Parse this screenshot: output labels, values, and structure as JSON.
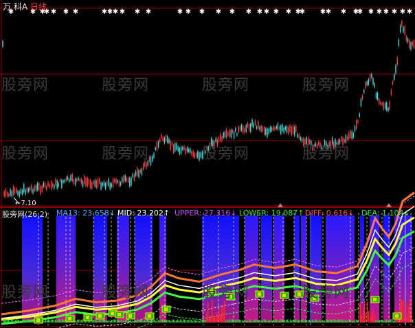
{
  "window_title": {
    "stock_name": "万 科A",
    "timeframe": "日线"
  },
  "main_chart": {
    "low_label": "7.10"
  },
  "indicator": {
    "name": "股旁网(26,2)",
    "items": [
      {
        "label": "MA13: 23.658↓",
        "color": "#4aa8ff"
      },
      {
        "label": "MID: 23.202↑",
        "color": "#ffffff"
      },
      {
        "label": "UPPER: 27.316↓",
        "color": "#d246ff"
      },
      {
        "label": "LOWER: 19.087↑",
        "color": "#39e639"
      },
      {
        "label": "DIFF: 0.616↓",
        "color": "#ff5050"
      },
      {
        "label": "DEA: 1.104↓",
        "color": "#39e639"
      }
    ]
  },
  "watermark": "股旁网",
  "colors": {
    "background": "#000000",
    "grid": "#8b0000",
    "up_candle": "#ff4040",
    "down_candle": "#40e0e0",
    "star": "#ffffff"
  }
}
